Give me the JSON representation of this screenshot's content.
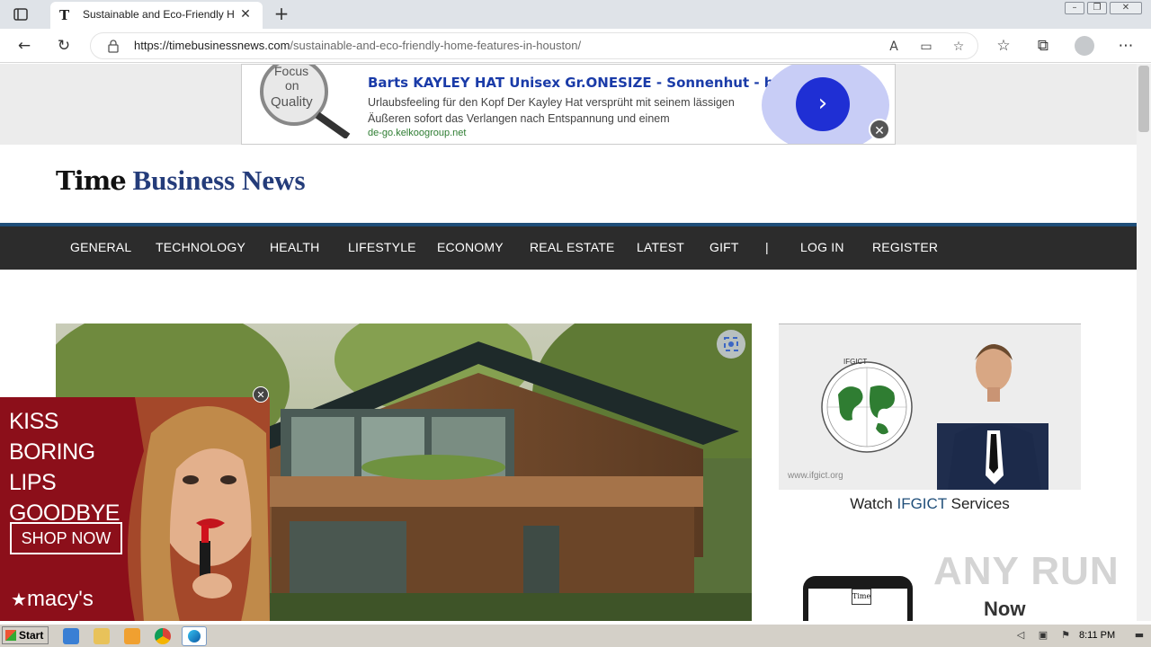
{
  "browser": {
    "tab_title": "Sustainable and Eco-Friendly Home Features in Houston",
    "tab_favicon": "T",
    "url_host": "https://timebusinessnews.com",
    "url_path": "/sustainable-and-eco-friendly-home-features-in-houston/",
    "new_tab_symbol": "+",
    "close_symbol": "✕"
  },
  "top_ad": {
    "title": "Barts KAYLEY HAT Unisex Gr.ONESIZE - Sonnenhut - beige-",
    "description": "Urlaubsfeeling für den Kopf Der Kayley Hat versprüht mit seinem lässigen Äußeren sofort das Verlangen nach Entspannung und einem",
    "host": "de-go.kelkoogroup.net",
    "image_text_1": "Focus",
    "image_text_2": "on",
    "image_text_3": "Quality",
    "cta_symbol": "›",
    "close_symbol": "✕"
  },
  "site": {
    "logo_part1": "Time",
    "logo_part2": "Business News"
  },
  "nav": {
    "items": [
      "GENERAL",
      "TECHNOLOGY",
      "HEALTH",
      "LIFESTYLE",
      "ECONOMY",
      "REAL ESTATE",
      "LATEST",
      "GIFT",
      "|",
      "LOG IN",
      "REGISTER"
    ]
  },
  "side_ad": {
    "org_name": "IFGICT",
    "site_url": "www.ifgict.org",
    "watch_prefix": "Watch ",
    "watch_accent": "IFGICT",
    "watch_suffix": " Services",
    "phone_logo": "Time",
    "now_label": "Now"
  },
  "watermark": "ANY RUN",
  "bottom_ad": {
    "headline_1": "KISS BORING",
    "headline_2": "LIPS GOODBYE",
    "shop_label": "SHOP NOW",
    "brand": "macy's",
    "close_symbol": "✕"
  },
  "taskbar": {
    "start_label": "Start",
    "clock": "8:11 PM"
  },
  "colors": {
    "nav_bg": "#2c2c2c",
    "nav_accent": "#1f4e79",
    "logo_blue": "#243c7a",
    "ad_title_blue": "#1a3ba8",
    "macys_red": "#8c0f1a"
  }
}
